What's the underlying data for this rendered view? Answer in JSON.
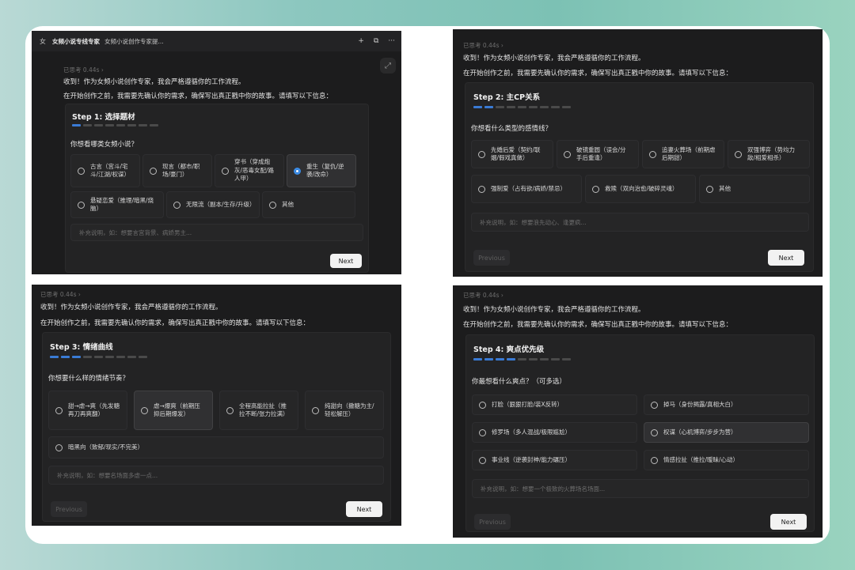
{
  "panel1": {
    "app_logo": "女",
    "app_title": "女频小说专线专家",
    "app_sub": "女频小说创作专家提...",
    "topbar_icons": [
      "+",
      "⧉",
      "···"
    ],
    "think": "已思考 0.44s ›",
    "msg1": "收到！作为女频小说创作专家，我会严格遵循你的工作流程。",
    "msg2": "在开始创作之前，我需要先确认你的需求，确保写出真正戳中你的故事。请填写以下信息：",
    "step_title": "Step 1: 选择题材",
    "question": "你想看哪类女频小说？",
    "options": [
      "古言（宫斗/宅斗/江湖/权谋）",
      "现言（都市/职场/豪门）",
      "穿书（穿成炮灰/恶毒女配/路人甲）",
      "重生（复仇/逆袭/改命）",
      "悬疑恋爱（推理/暗黑/烧脑）",
      "无限流（副本/生存/升级）",
      "其他"
    ],
    "note_placeholder": "补充说明，如：想要言宫背景、病娇男主...",
    "next": "Next"
  },
  "panel2": {
    "think": "已思考 0.44s ›",
    "msg1": "收到！作为女频小说创作专家，我会严格遵循你的工作流程。",
    "msg2": "在开始创作之前，我需要先确认你的需求，确保写出真正戳中你的故事。请填写以下信息：",
    "step_title": "Step 2: 主CP关系",
    "question": "你想看什么类型的感情线？",
    "options": [
      "先婚后爱（契约/联姻/假戏真做）",
      "破镜重圆（误会/分手后重逢）",
      "追妻火葬场（前期虐后期甜）",
      "双强博弈（势均力敌/相爱相杀）",
      "强制爱（占有欲/病娇/禁忌）",
      "救赎（双向治愈/破碎灵魂）",
      "其他"
    ],
    "note_placeholder": "补充说明，如：想要浪先动心、逢更疯...",
    "previous": "Previous",
    "next": "Next"
  },
  "panel3": {
    "think": "已思考 0.44s ›",
    "msg1": "收到！作为女频小说创作专家，我会严格遵循你的工作流程。",
    "msg2": "在开始创作之前，我需要先确认你的需求，确保写出真正戳中你的故事。请填写以下信息：",
    "step_title": "Step 3: 情绪曲线",
    "question": "你想要什么样的情绪节奏？",
    "options": [
      "甜→虐→爽（先发糖再刀再爽翻）",
      "虐→爆爽（前期压抑后期爆发）",
      "全程高能拉扯（推拉不断/张力拉满）",
      "纯甜向（撒糖为主/轻松解压）",
      "暗黑向（致郁/现实/不完美）"
    ],
    "note_placeholder": "补充说明，如：想要名场面多虐一点...",
    "previous": "Previous",
    "next": "Next"
  },
  "panel4": {
    "think": "已思考 0.44s ›",
    "msg1": "收到！作为女频小说创作专家，我会严格遵循你的工作流程。",
    "msg2": "在开始创作之前，我需要先确认你的需求，确保写出真正戳中你的故事。请填写以下信息：",
    "step_title": "Step 4: 爽点优先级",
    "question": "你最想看什么爽点？（可多选）",
    "options": [
      "打脸（狠狠打脸/装X反转）",
      "掉马（身份揭露/真相大白）",
      "修罗场（多人混战/极限尴尬）",
      "权谋（心机博弈/步步为营）",
      "事业线（逆袭封神/能力碾压）",
      "情感拉扯（推拉/暧昧/心动）"
    ],
    "note_placeholder": "补充说明，如：想要一个极致的火葬场名场面...",
    "previous": "Previous",
    "next": "Next"
  }
}
